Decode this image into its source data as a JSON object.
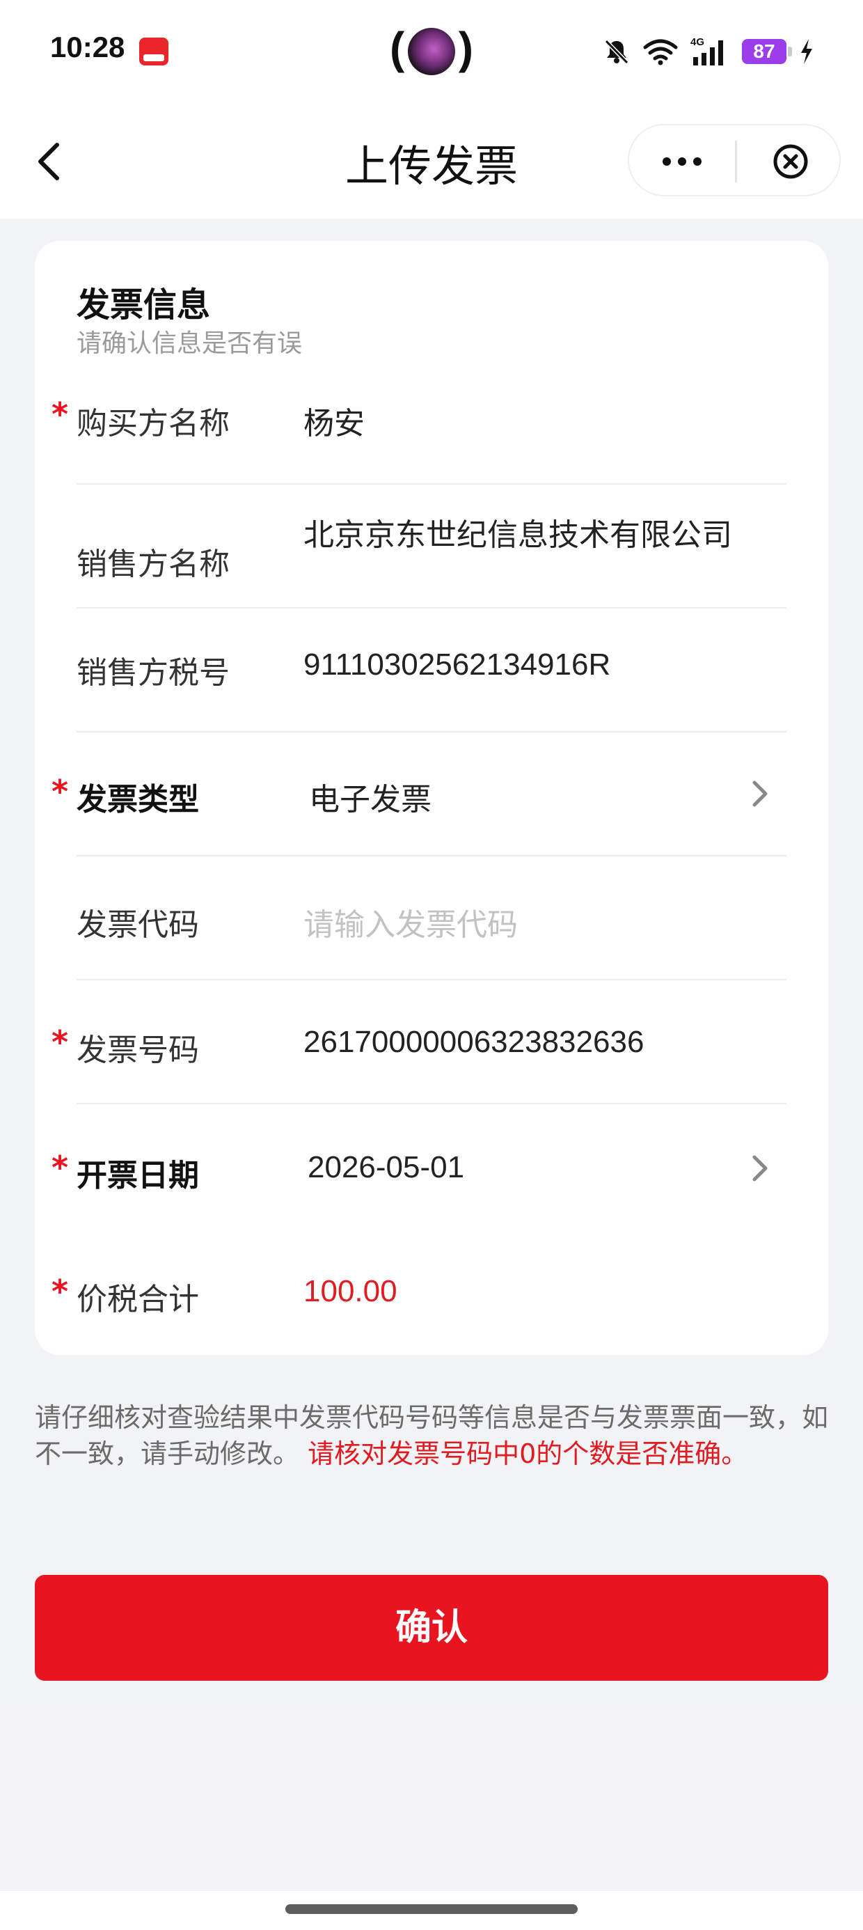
{
  "status_bar": {
    "time": "10:28",
    "battery": "87"
  },
  "nav": {
    "title": "上传发票"
  },
  "card": {
    "title": "发票信息",
    "subtitle": "请确认信息是否有误",
    "fields": [
      {
        "label": "购买方名称",
        "value": "杨安",
        "required": true
      },
      {
        "label": "销售方名称",
        "value": "北京京东世纪信息技术有限公司",
        "required": false
      },
      {
        "label": "销售方税号",
        "value": "91110302562134916R",
        "required": false
      },
      {
        "label": "发票类型",
        "value": "电子发票",
        "required": true
      },
      {
        "label": "发票代码",
        "value": "",
        "placeholder": "请输入发票代码",
        "required": false
      },
      {
        "label": "发票号码",
        "value": "26170000006323832636",
        "required": true
      },
      {
        "label": "开票日期",
        "value": "2026-05-01",
        "required": true
      },
      {
        "label": "价税合计",
        "value": "100.00",
        "required": true
      }
    ]
  },
  "notice": {
    "text": "请仔细核对查验结果中发票代码号码等信息是否与发票票面一致，如不一致，请手动修改。",
    "warning": "请核对发票号码中0的个数是否准确。"
  },
  "confirm_button": {
    "label": "确认"
  },
  "colors": {
    "accent": "#e8141f",
    "required_star": "#e8141f",
    "placeholder": "#c2c2c2",
    "background": "#f2f3f5"
  },
  "icons": {
    "back": "chevron-left-icon",
    "more": "more-dots-icon",
    "close": "close-circle-icon",
    "row_arrow": "chevron-right-icon"
  }
}
